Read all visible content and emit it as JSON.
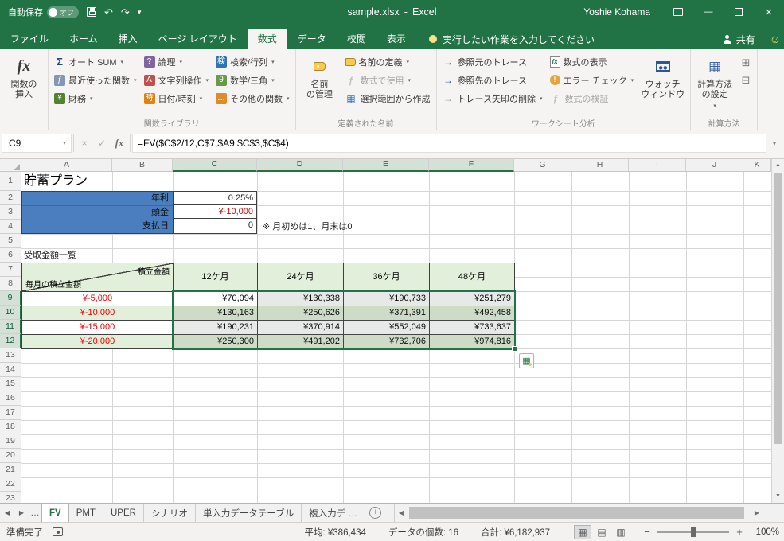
{
  "titlebar": {
    "autosave_label": "自動保存",
    "autosave_state": "オフ",
    "doc_title": "sample.xlsx",
    "separator": "-",
    "app_name": "Excel",
    "user_name": "Yoshie Kohama"
  },
  "ribbon_tabs": {
    "file": "ファイル",
    "tabs": [
      "ホーム",
      "挿入",
      "ページ レイアウト",
      "数式",
      "データ",
      "校閲",
      "表示"
    ],
    "active": "数式",
    "tellme": "実行したい作業を入力してください",
    "share": "共有"
  },
  "ribbon": {
    "insert_function": {
      "line1": "関数の",
      "line2": "挿入"
    },
    "function_library": {
      "group_label": "関数ライブラリ",
      "buttons": [
        {
          "name": "autosum",
          "label": "オート SUM",
          "icon": "Σ",
          "dropdown": true
        },
        {
          "name": "recently-used",
          "label": "最近使った関数",
          "icon": "ƒ",
          "icon_bg": "#8496b0",
          "dropdown": true
        },
        {
          "name": "financial",
          "label": "財務",
          "icon": "¥",
          "icon_bg": "#548235",
          "dropdown": true
        },
        {
          "name": "logical",
          "label": "論理",
          "icon": "?",
          "icon_bg": "#8064a2",
          "dropdown": true
        },
        {
          "name": "text",
          "label": "文字列操作",
          "icon": "A",
          "icon_bg": "#c0504d",
          "dropdown": true
        },
        {
          "name": "date-time",
          "label": "日付/時刻",
          "icon": "時",
          "icon_bg": "#e08214",
          "dropdown": true
        },
        {
          "name": "lookup-reference",
          "label": "検索/行列",
          "icon": "検",
          "icon_bg": "#2e75b6",
          "dropdown": true
        },
        {
          "name": "math-trig",
          "label": "数学/三角",
          "icon": "θ",
          "icon_bg": "#6a9a48",
          "dropdown": true
        },
        {
          "name": "more-functions",
          "label": "その他の関数",
          "icon": "…",
          "icon_bg": "#d98e2b",
          "dropdown": true
        }
      ]
    },
    "defined_names": {
      "group_label": "定義された名前",
      "name_manager": {
        "line1": "名前",
        "line2": "の管理"
      },
      "buttons": [
        {
          "name": "define-name",
          "label": "名前の定義",
          "icon_class": "tagsm",
          "dropdown": true
        },
        {
          "name": "use-in-formula",
          "label": "数式で使用",
          "icon": "ƒ",
          "icon_class": "aicon",
          "icon_color": "#8a8886",
          "dropdown": true,
          "disabled": true
        },
        {
          "name": "create-from-selection",
          "label": "選択範囲から作成",
          "icon": "▦",
          "icon_class": "aicon",
          "icon_color": "#2e75b6"
        }
      ]
    },
    "auditing": {
      "group_label": "ワークシート分析",
      "buttons": [
        {
          "name": "trace-precedents",
          "label": "参照元のトレース",
          "icon": "→",
          "icon_class": "aicon",
          "icon_color": "#2b579a"
        },
        {
          "name": "trace-dependents",
          "label": "参照先のトレース",
          "icon": "→",
          "icon_class": "aicon",
          "icon_color": "#2b579a"
        },
        {
          "name": "remove-arrows",
          "label": "トレース矢印の削除",
          "icon": "→",
          "icon_class": "aicon",
          "icon_color": "#9a9a9a",
          "dropdown": true
        },
        {
          "name": "show-formulas",
          "label": "数式の表示",
          "icon": "fx",
          "icon_class": "docicon"
        },
        {
          "name": "error-checking",
          "label": "エラー チェック",
          "icon": "!",
          "icon_class": "erricon",
          "dropdown": true
        },
        {
          "name": "evaluate-formula",
          "label": "数式の検証",
          "icon": "ƒ",
          "icon_class": "aicon",
          "icon_color": "#8a8886",
          "disabled": true
        }
      ]
    },
    "watch_window": {
      "line1": "ウォッチ",
      "line2": "ウィンドウ"
    },
    "calculation": {
      "group_label": "計算方法",
      "options": {
        "line1": "計算方法",
        "line2": "の設定"
      }
    }
  },
  "formula_bar": {
    "name_box": "C9",
    "formula": "=FV($C$2/12,C$7,$A9,$C$3,$C$4)"
  },
  "sheet": {
    "columns": [
      "A",
      "B",
      "C",
      "D",
      "E",
      "F",
      "G",
      "H",
      "I",
      "J",
      "K"
    ],
    "selected_columns": [
      "C",
      "D",
      "E",
      "F"
    ],
    "selected_rows": [
      9,
      10,
      11,
      12
    ],
    "active_cell": "C9",
    "title": "貯蓄プラン",
    "params": [
      {
        "label": "年利",
        "value": "0.25%"
      },
      {
        "label": "頭金",
        "value": "¥-10,000"
      },
      {
        "label": "支払日",
        "value": "0"
      }
    ],
    "note": "※ 月初めは1、月末は0",
    "section_title": "受取金額一覧",
    "table": {
      "corner_top": "積立金額",
      "corner_bottom": "毎月の積立金額",
      "col_headers": [
        "12ケ月",
        "24ケ月",
        "36ケ月",
        "48ケ月"
      ],
      "rows": [
        {
          "label": "¥-5,000",
          "values": [
            "¥70,094",
            "¥130,338",
            "¥190,733",
            "¥251,279"
          ]
        },
        {
          "label": "¥-10,000",
          "values": [
            "¥130,163",
            "¥250,626",
            "¥371,391",
            "¥492,458"
          ]
        },
        {
          "label": "¥-15,000",
          "values": [
            "¥190,231",
            "¥370,914",
            "¥552,049",
            "¥733,637"
          ]
        },
        {
          "label": "¥-20,000",
          "values": [
            "¥250,300",
            "¥491,202",
            "¥732,706",
            "¥974,816"
          ]
        }
      ]
    }
  },
  "sheet_tabs": {
    "tabs": [
      "FV",
      "PMT",
      "UPER",
      "シナリオ",
      "単入力データテーブル",
      "複入力デ …"
    ],
    "active": "FV"
  },
  "status_bar": {
    "ready": "準備完了",
    "average": "平均: ¥386,434",
    "count": "データの個数: 16",
    "sum": "合計: ¥6,182,937",
    "zoom": "100%"
  },
  "colors": {
    "accent_green": "#217346",
    "band_green": "#e2efda",
    "label_blue": "#4a7ebf",
    "negative_red": "#e80000"
  },
  "glyphs": {
    "fx": "fx",
    "dropdown": "▾",
    "undo": "↶",
    "redo": "↷",
    "customize_qat": "▾",
    "minimize": "—",
    "close": "×",
    "cancel": "×",
    "enter": "✓",
    "scroll_up": "▲",
    "scroll_down": "▼",
    "scroll_left": "◀",
    "scroll_right": "▶",
    "ellipsis": "…",
    "add": "+",
    "zoom_out": "−",
    "zoom_in": "+",
    "calc_icon": "▦",
    "calc_now": "⊞",
    "calc_sheet": "⊟",
    "view_normal": "▦",
    "view_layout": "▤",
    "view_break": "▥",
    "smiley": "☺",
    "qa": "▦",
    "expand": "▾"
  }
}
